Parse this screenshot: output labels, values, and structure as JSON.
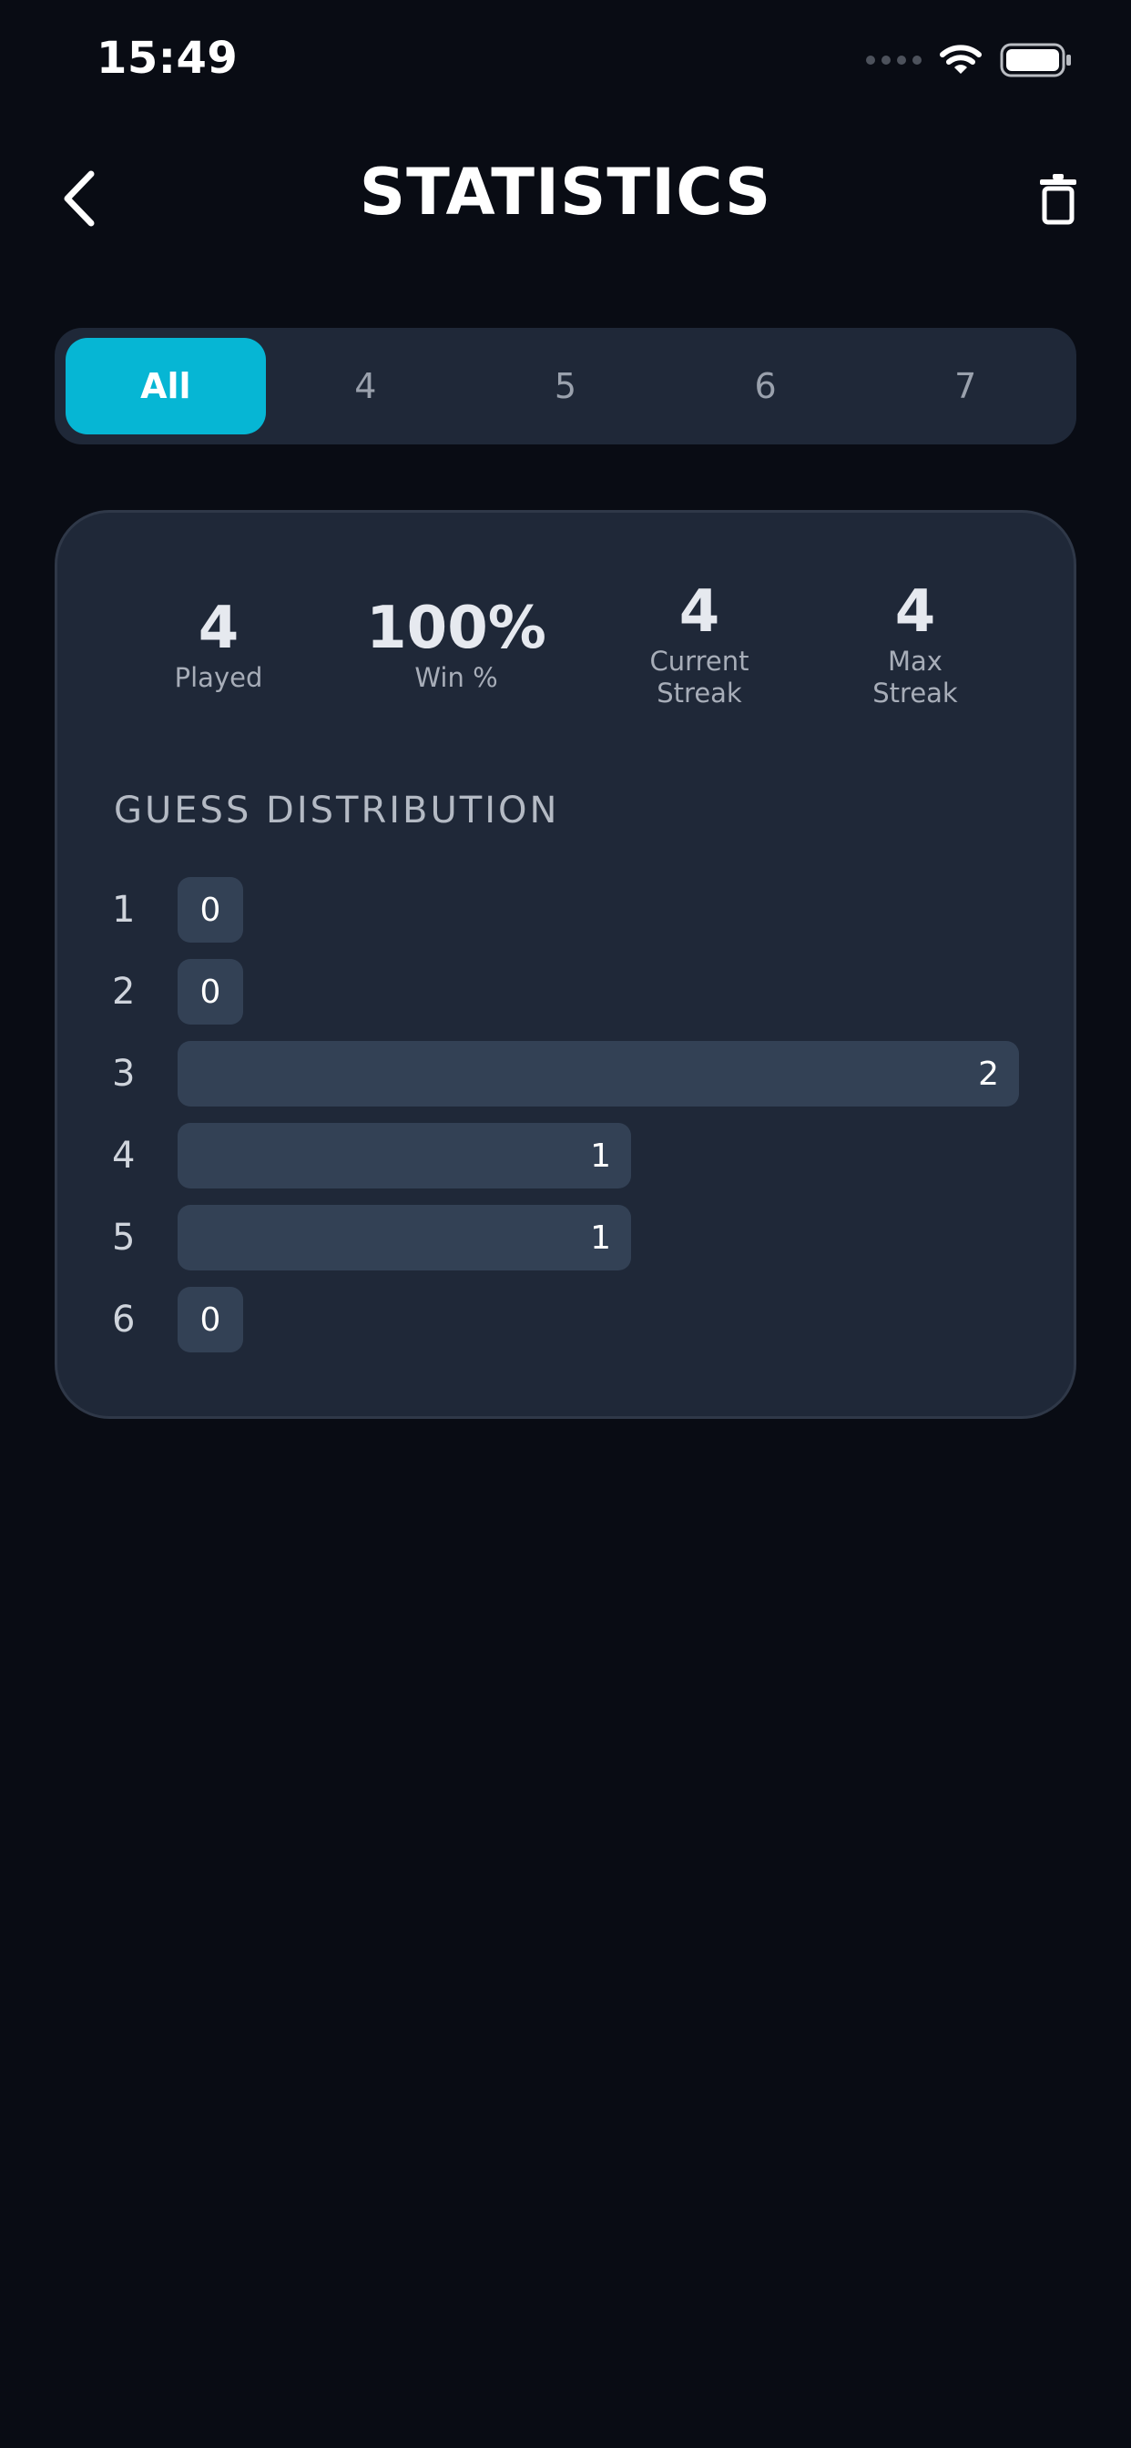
{
  "status_bar": {
    "time": "15:49"
  },
  "header": {
    "title": "STATISTICS"
  },
  "tabs": [
    {
      "label": "All",
      "active": true
    },
    {
      "label": "4",
      "active": false
    },
    {
      "label": "5",
      "active": false
    },
    {
      "label": "6",
      "active": false
    },
    {
      "label": "7",
      "active": false
    }
  ],
  "stats": {
    "played": {
      "value": "4",
      "label": "Played"
    },
    "win_pct": {
      "value": "100%",
      "label": "Win %"
    },
    "current_streak": {
      "value": "4",
      "label_line1": "Current",
      "label_line2": "Streak"
    },
    "max_streak": {
      "value": "4",
      "label_line1": "Max",
      "label_line2": "Streak"
    }
  },
  "guess_distribution": {
    "title": "GUESS DISTRIBUTION",
    "rows": [
      {
        "guess": "1",
        "count": 0
      },
      {
        "guess": "2",
        "count": 0
      },
      {
        "guess": "3",
        "count": 2
      },
      {
        "guess": "4",
        "count": 1
      },
      {
        "guess": "5",
        "count": 1
      },
      {
        "guess": "6",
        "count": 0
      }
    ]
  },
  "colors": {
    "background": "#090c14",
    "card": "#1f2838",
    "accent": "#06b6d4",
    "bar": "#334155"
  },
  "icons": {
    "back": "chevron-left-icon",
    "delete": "trash-icon",
    "wifi": "wifi-icon",
    "battery": "battery-icon",
    "signal": "signal-dots-icon"
  }
}
